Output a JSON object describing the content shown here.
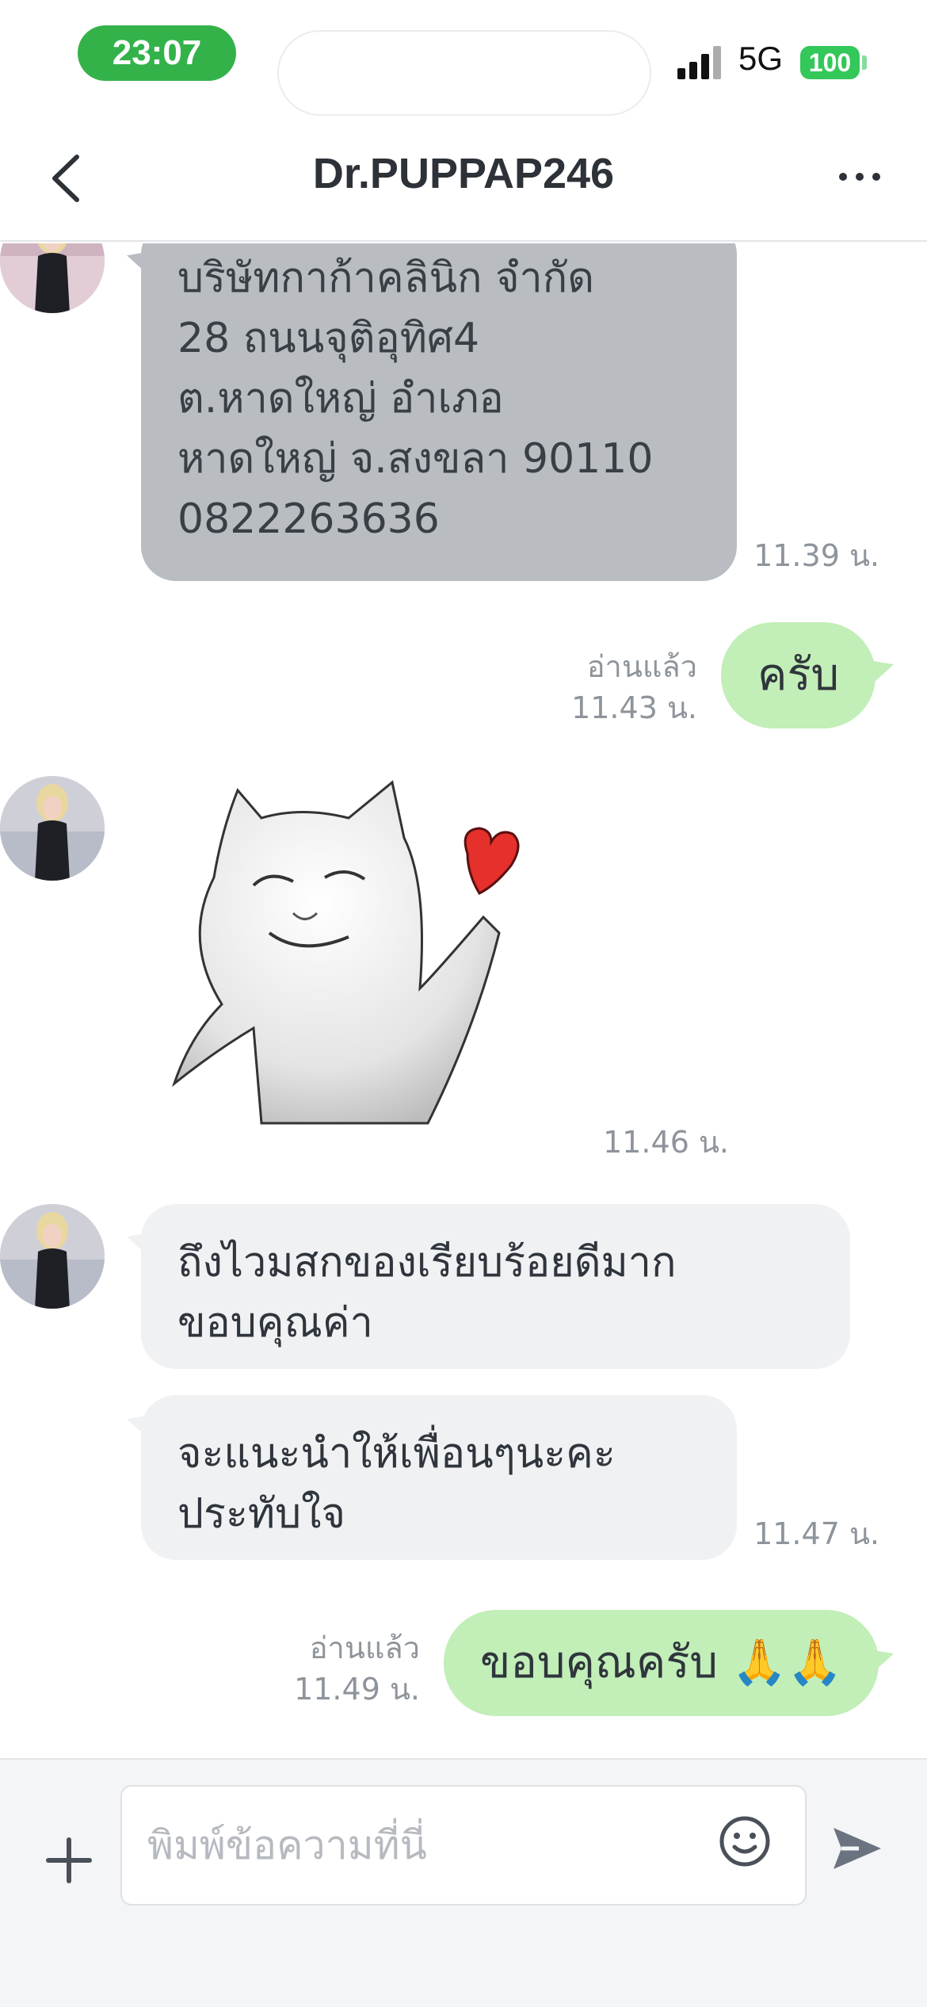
{
  "status_bar": {
    "time": "23:07",
    "network": "5G",
    "battery": "100"
  },
  "header": {
    "title": "Dr.PUPPAP246"
  },
  "messages": [
    {
      "type": "text",
      "side": "in",
      "text": "บริษัทกาก้าคลินิก จำกัด\n28 ถนนจุติอุทิศ4\n ต.หาดใหญ่ อำเภอ\nหาดใหญ่ จ.สงขลา 90110\n0822263636",
      "time": "11.39 น."
    },
    {
      "type": "text",
      "side": "out",
      "text": "ครับ",
      "read": "อ่านแล้ว",
      "time": "11.43 น."
    },
    {
      "type": "sticker",
      "side": "in",
      "sticker": "cat-heart-sticker",
      "time": "11.46 น."
    },
    {
      "type": "text",
      "side": "in",
      "text": "ถึงไวมสกของเรียบร้อยดีมาก\nขอบคุณค่า"
    },
    {
      "type": "text",
      "side": "in",
      "text": "จะแนะนำให้เพื่อนๆนะคะ\nประทับใจ",
      "time": "11.47 น."
    },
    {
      "type": "text",
      "side": "out",
      "text": "ขอบคุณครับ 🙏🙏",
      "read": "อ่านแล้ว",
      "time": "11.49 น."
    }
  ],
  "composer": {
    "placeholder": "พิมพ์ข้อความที่นี่"
  },
  "icons": [
    "back-icon",
    "more-icon",
    "plus-icon",
    "emoji-icon",
    "send-icon"
  ],
  "colors": {
    "accent": "#34b24a",
    "outgoing": "#c2eeb8",
    "incoming": "#f0f1f3",
    "address_bubble": "#b9bdc2"
  }
}
